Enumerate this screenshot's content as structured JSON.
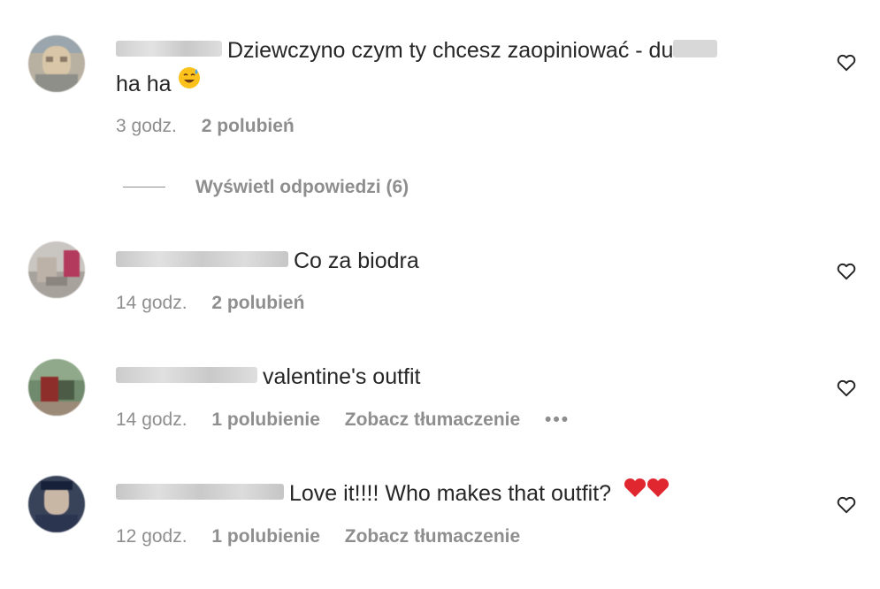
{
  "comments": [
    {
      "text": "Dziewczyno czym ty chcesz zaopiniować - du",
      "text_cont": "ha ha",
      "emoji": "smiling-face-with-sweat-emoji",
      "time": "3 godz.",
      "likes": "2 polubień"
    },
    {
      "text": "Co za biodra",
      "time": "14 godz.",
      "likes": "2 polubień"
    },
    {
      "text": "valentine's outfit",
      "time": "14 godz.",
      "likes": "1 polubienie",
      "translate": "Zobacz tłumaczenie",
      "more": "•••"
    },
    {
      "text": "Love it!!!! Who makes that outfit?",
      "emoji": "two-red-hearts-emoji",
      "time": "12 godz.",
      "likes": "1 polubienie",
      "translate": "Zobacz tłumaczenie"
    }
  ],
  "view_replies": "Wyświetl odpowiedzi (6)",
  "colors": {
    "text": "#262626",
    "meta": "#8e8e8e",
    "heart_red": "#e0262f"
  }
}
